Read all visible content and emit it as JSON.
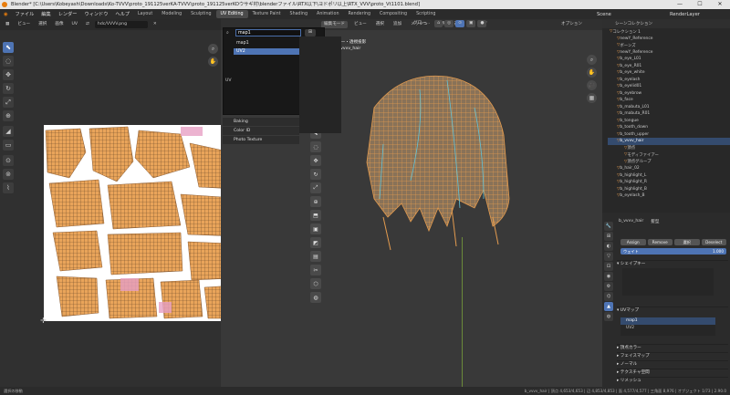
{
  "window": {
    "title": "Blender* [C:\\Users\\Kobeyash\\Downloads\\Ko-TVVV\\proto_191125verKA-TVVV\\proto_191125verKOウサギ村\\blenderファイル\\RTX以下\\ヨドポリ以上\\RTX_VVV\\proto_Vt1101.blend]",
    "minimize": "—",
    "maximize": "☐",
    "close": "✕"
  },
  "menu": {
    "items": [
      "ファイル",
      "編集",
      "レンダー",
      "ウィンドウ",
      "ヘルプ"
    ],
    "workspaces": [
      "Layout",
      "Modeling",
      "Sculpting",
      "UV Editing",
      "Texture Paint",
      "Shading",
      "Animation",
      "Rendering",
      "Compositing",
      "Scripting"
    ],
    "active_workspace": "UV Editing",
    "scene": "Scene",
    "view_layer": "RenderLayer"
  },
  "uv_editor": {
    "header": [
      "ビュー",
      "選択",
      "画像",
      "UV"
    ],
    "image_name": "hdc/VVVV.png",
    "tools": [
      "⬉",
      "◌",
      "✥",
      "↻",
      "⤢",
      "⊕",
      "◢",
      "▭",
      "⊙",
      "⊚",
      "⌇"
    ]
  },
  "viewport": {
    "mode": "編集モード",
    "header": [
      "ビュー",
      "選択",
      "追加",
      "メッシュ",
      "頂点",
      "辺",
      "面",
      "UV"
    ],
    "shading_label": "グロー...",
    "options_label": "オプション",
    "user_label": "ユーザー・透視投影",
    "object_label": "(1) b_vvvv_hair"
  },
  "dropdown": {
    "search_value": "map1",
    "items": [
      "map1",
      "UV2"
    ],
    "highlighted": "UV2",
    "panels": [
      "Baking",
      "Color ID",
      "Photo Texture"
    ],
    "side_label": "UV"
  },
  "outliner": {
    "title": "シーンコレクション",
    "rows": [
      "コレクション 1",
      "newY_Reference",
      "ボーンズ",
      "newY_Reference",
      "b_eye_L01",
      "b_eye_R01",
      "b_eye_white",
      "b_eyelash",
      "b_eyelid01",
      "b_eyebrow",
      "b_face",
      "b_mabuta_L01",
      "b_mabuta_R01",
      "b_tongue",
      "b_tooth_down",
      "b_tooth_upper",
      "b_vvvv_hair",
      "頂点",
      "モディファイアー",
      "頂点グループ",
      "b_hair_02",
      "b_highlight_L",
      "b_highlight_R",
      "b_highlight_B",
      "b_eyelash_B"
    ],
    "selected_index": 16
  },
  "properties": {
    "object_name": "b_vvvv_hair",
    "data_label": "髪型",
    "buttons": [
      "Assign",
      "Remove",
      "選択",
      "Deselect"
    ],
    "weight_label": "ウェイト",
    "weight_value": "1.000",
    "sections": [
      "シェイプキー",
      "UVマップ",
      "頂点カラー",
      "フェイスマップ",
      "ノーマル",
      "テクスチャ空間",
      "リメッシュ"
    ],
    "uvmaps": [
      "map1",
      "UV2"
    ],
    "tabs": [
      "🔧",
      "⊞",
      "◐",
      "▽",
      "⊡",
      "◉",
      "⚙",
      "⌬",
      "▲",
      "◍"
    ]
  },
  "statusbar": {
    "left": "選択の移動",
    "right": "b_vvvv_hair | 頂点 4,653/4,653 | 辺 4,853/4,853 | 面 4,577/4,577 | 三角面 8,976 | オブジェクト 1/73 | 2.90.0"
  },
  "colors": {
    "accent": "#4e74b4",
    "uv_orange": "#e9a45a",
    "mesh_orange": "#d89a55",
    "seam_cyan": "#63c4d8"
  }
}
